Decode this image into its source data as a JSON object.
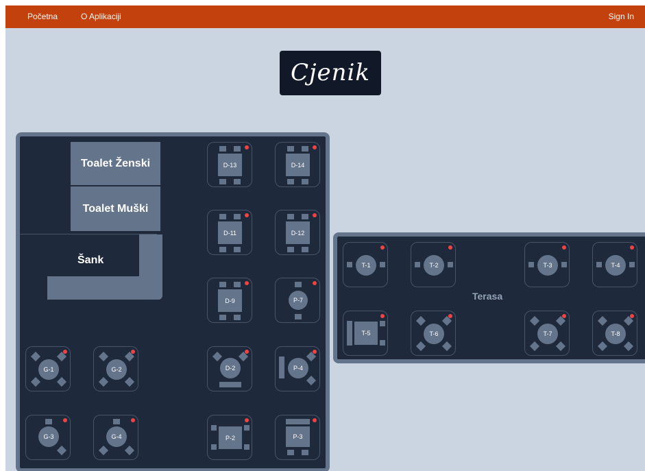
{
  "nav": {
    "home_label": "Početna",
    "about_label": "O Aplikaciji",
    "signin_label": "Sign In"
  },
  "page": {
    "title": "Cjenik"
  },
  "indoor": {
    "toilet_women_label": "Toalet Ženski",
    "toilet_men_label": "Toalet Muški",
    "bar_label": "Šank",
    "tables": {
      "d13": "D-13",
      "d14": "D-14",
      "d11": "D-11",
      "d12": "D-12",
      "d9": "D-9",
      "p7": "P-7",
      "d2": "D-2",
      "p4": "P-4",
      "p2": "P-2",
      "p3": "P-3",
      "g1": "G-1",
      "g2": "G-2",
      "g3": "G-3",
      "g4": "G-4"
    }
  },
  "terrace": {
    "label": "Terasa",
    "tables": {
      "t1": "T-1",
      "t2": "T-2",
      "t3": "T-3",
      "t4": "T-4",
      "t5": "T-5",
      "t6": "T-6",
      "t7": "T-7",
      "t8": "T-8"
    }
  },
  "colors": {
    "navbar": "#c2410c",
    "background": "#cbd5e1",
    "floor": "#1e293b",
    "furniture": "#64748b",
    "status_dot": "#ef4444"
  }
}
